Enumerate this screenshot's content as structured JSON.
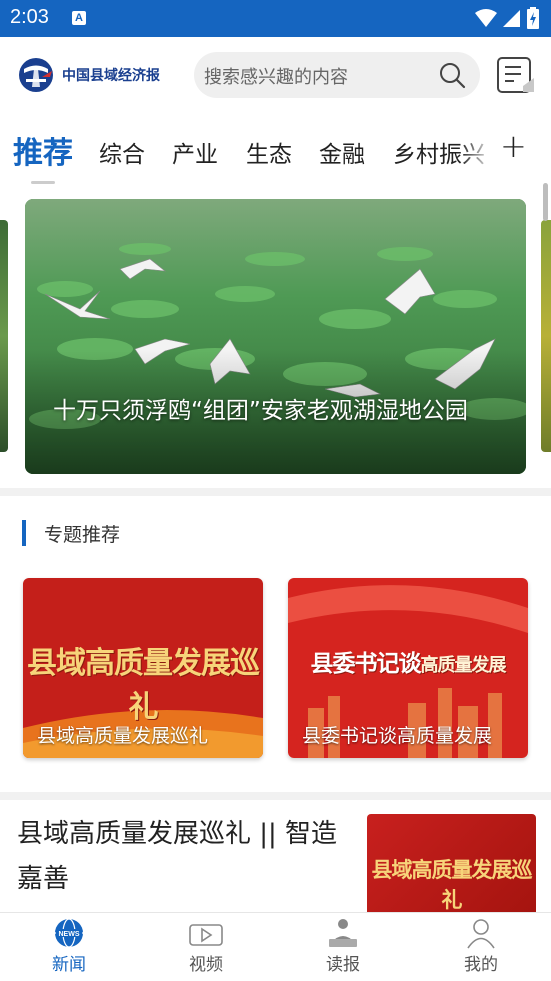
{
  "status_bar": {
    "time": "2:03",
    "notification_badge": "A"
  },
  "header": {
    "logo_text": "中国县域经济报",
    "search_placeholder": "搜索感兴趣的内容",
    "paper_icon": "newspaper-icon"
  },
  "tabs": [
    {
      "label": "推荐",
      "active": true
    },
    {
      "label": "综合",
      "active": false
    },
    {
      "label": "产业",
      "active": false
    },
    {
      "label": "生态",
      "active": false
    },
    {
      "label": "金融",
      "active": false
    },
    {
      "label": "乡村振兴",
      "active": false
    }
  ],
  "tabs_more_label": "+",
  "carousel": {
    "caption": "十万只须浮鸥“组团”安家老观湖湿地公园"
  },
  "special_topics": {
    "title": "专题推荐",
    "items": [
      {
        "art_text": "县域高质量发展巡礼",
        "caption": "县域高质量发展巡礼"
      },
      {
        "art_text_a": "县委书记谈",
        "art_text_b": "高质量发展",
        "caption": "县委书记谈高质量发展"
      }
    ]
  },
  "news": [
    {
      "title": "县域高质量发展巡礼 || 智造嘉善",
      "thumb_text": "县域高质量发展巡礼"
    }
  ],
  "bottom_nav": [
    {
      "label": "新闻",
      "icon": "news-globe-icon",
      "active": true
    },
    {
      "label": "视频",
      "icon": "video-icon",
      "active": false
    },
    {
      "label": "读报",
      "icon": "reader-icon",
      "active": false
    },
    {
      "label": "我的",
      "icon": "person-icon",
      "active": false
    }
  ],
  "colors": {
    "accent": "#1565c0",
    "topic_red": "#c8201e",
    "topic_gold": "#f7d47a"
  }
}
